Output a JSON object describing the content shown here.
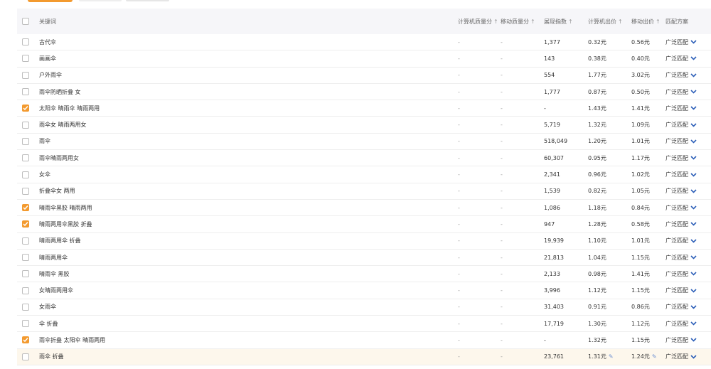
{
  "header": {
    "keyword": "关键词",
    "pc_quality": "计算机质量分",
    "mobile_quality": "移动质量分",
    "impressions": "展现指数",
    "pc_bid": "计算机出价",
    "mobile_bid": "移动出价",
    "match": "匹配方案",
    "sort_icon": "↑"
  },
  "rows": [
    {
      "keyword": "古代伞",
      "q1": "-",
      "q2": "-",
      "show": "1,377",
      "pc": "0.32元",
      "mob": "0.56元",
      "match": "广泛匹配",
      "checked": false
    },
    {
      "keyword": "画画伞",
      "q1": "-",
      "q2": "-",
      "show": "143",
      "pc": "0.38元",
      "mob": "0.40元",
      "match": "广泛匹配",
      "checked": false
    },
    {
      "keyword": "户外雨伞",
      "q1": "-",
      "q2": "-",
      "show": "554",
      "pc": "1.77元",
      "mob": "3.02元",
      "match": "广泛匹配",
      "checked": false
    },
    {
      "keyword": "雨伞防晒折叠 女",
      "q1": "-",
      "q2": "-",
      "show": "1,777",
      "pc": "0.87元",
      "mob": "0.50元",
      "match": "广泛匹配",
      "checked": false
    },
    {
      "keyword": "太阳伞 晴雨伞 晴雨两用",
      "q1": "-",
      "q2": "-",
      "show": "-",
      "pc": "1.43元",
      "mob": "1.41元",
      "match": "广泛匹配",
      "checked": true
    },
    {
      "keyword": "雨伞女 晴雨两用女",
      "q1": "-",
      "q2": "-",
      "show": "5,719",
      "pc": "1.32元",
      "mob": "1.09元",
      "match": "广泛匹配",
      "checked": false
    },
    {
      "keyword": "雨伞",
      "q1": "-",
      "q2": "-",
      "show": "518,049",
      "pc": "1.20元",
      "mob": "1.01元",
      "match": "广泛匹配",
      "checked": false
    },
    {
      "keyword": "雨伞晴雨两用女",
      "q1": "-",
      "q2": "-",
      "show": "60,307",
      "pc": "0.95元",
      "mob": "1.17元",
      "match": "广泛匹配",
      "checked": false
    },
    {
      "keyword": "女伞",
      "q1": "-",
      "q2": "-",
      "show": "2,341",
      "pc": "0.96元",
      "mob": "1.02元",
      "match": "广泛匹配",
      "checked": false
    },
    {
      "keyword": "折叠伞女 两用",
      "q1": "-",
      "q2": "-",
      "show": "1,539",
      "pc": "0.82元",
      "mob": "1.05元",
      "match": "广泛匹配",
      "checked": false
    },
    {
      "keyword": "晴雨伞黑胶 晴雨两用",
      "q1": "-",
      "q2": "-",
      "show": "1,086",
      "pc": "1.18元",
      "mob": "0.84元",
      "match": "广泛匹配",
      "checked": true
    },
    {
      "keyword": "晴雨两用伞黑胶 折叠",
      "q1": "-",
      "q2": "-",
      "show": "947",
      "pc": "1.28元",
      "mob": "0.58元",
      "match": "广泛匹配",
      "checked": true
    },
    {
      "keyword": "晴雨两用伞 折叠",
      "q1": "-",
      "q2": "-",
      "show": "19,939",
      "pc": "1.10元",
      "mob": "1.01元",
      "match": "广泛匹配",
      "checked": false
    },
    {
      "keyword": "晴雨两用伞",
      "q1": "-",
      "q2": "-",
      "show": "21,813",
      "pc": "1.04元",
      "mob": "1.15元",
      "match": "广泛匹配",
      "checked": false
    },
    {
      "keyword": "晴雨伞 黑胶",
      "q1": "-",
      "q2": "-",
      "show": "2,133",
      "pc": "0.98元",
      "mob": "1.41元",
      "match": "广泛匹配",
      "checked": false
    },
    {
      "keyword": "女晴雨两用伞",
      "q1": "-",
      "q2": "-",
      "show": "3,996",
      "pc": "1.12元",
      "mob": "1.15元",
      "match": "广泛匹配",
      "checked": false
    },
    {
      "keyword": "女雨伞",
      "q1": "-",
      "q2": "-",
      "show": "31,403",
      "pc": "0.91元",
      "mob": "0.86元",
      "match": "广泛匹配",
      "checked": false
    },
    {
      "keyword": "伞 折叠",
      "q1": "-",
      "q2": "-",
      "show": "17,719",
      "pc": "1.30元",
      "mob": "1.12元",
      "match": "广泛匹配",
      "checked": false
    },
    {
      "keyword": "雨伞折叠 太阳伞 晴雨两用",
      "q1": "-",
      "q2": "-",
      "show": "-",
      "pc": "1.32元",
      "mob": "1.15元",
      "match": "广泛匹配",
      "checked": true
    },
    {
      "keyword": "雨伞 折叠",
      "q1": "-",
      "q2": "-",
      "show": "23,761",
      "pc": "1.31元",
      "mob": "1.24元",
      "match": "广泛匹配",
      "checked": false,
      "editing": true
    }
  ],
  "colors": {
    "accent": "#f39a2f",
    "chevron": "#2d5fb8",
    "highlight_row": "#fdf7ec"
  },
  "icons": {
    "sort": "arrow-up-icon",
    "match": "chevron-down-icon",
    "edit": "pencil-icon",
    "check": "check-icon"
  }
}
